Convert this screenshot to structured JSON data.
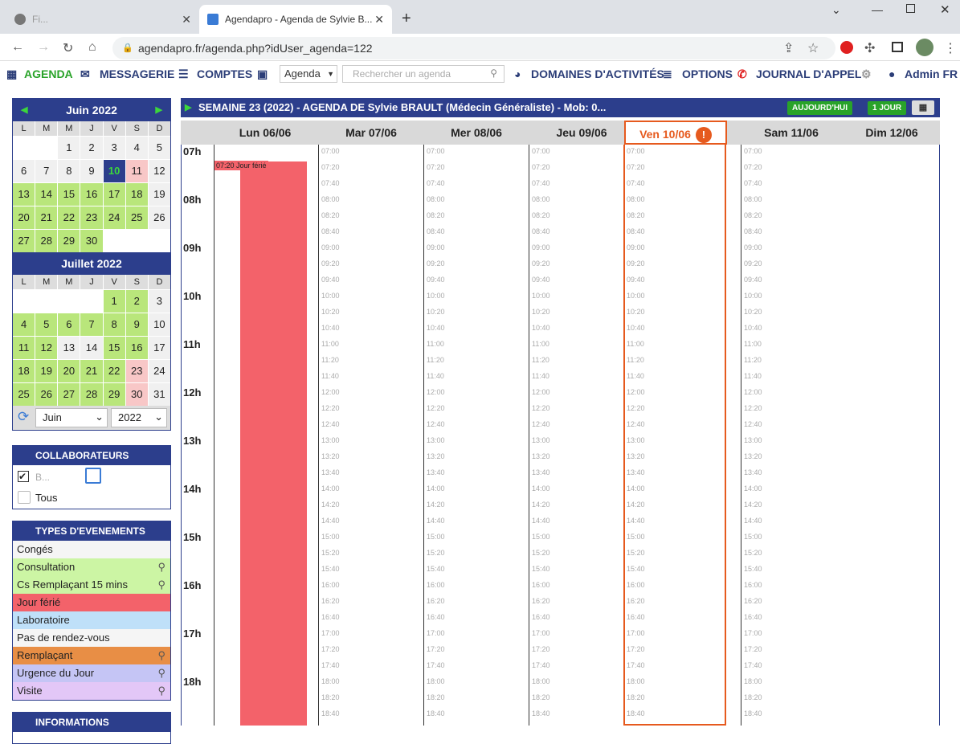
{
  "browser": {
    "tab1_title": "Fi...",
    "tab2_title": "Agendapro - Agenda de Sylvie B...",
    "url": "agendapro.fr/agenda.php?idUser_agenda=122"
  },
  "nav": {
    "agenda": "AGENDA",
    "messagerie": "MESSAGERIE",
    "comptes": "COMPTES",
    "select": "Agenda",
    "search_placeholder": "Rechercher un agenda",
    "domaines": "DOMAINES D'ACTIVITÉS",
    "options": "OPTIONS",
    "journal": "JOURNAL D'APPEL",
    "admin": "Admin FR"
  },
  "calendar": {
    "june": {
      "title": "Juin 2022",
      "dows": [
        "L",
        "M",
        "M",
        "J",
        "V",
        "S",
        "D"
      ],
      "days": [
        [
          "",
          ""
        ],
        [
          "",
          ""
        ],
        [
          "1",
          "w"
        ],
        [
          "2",
          "w"
        ],
        [
          "3",
          "w"
        ],
        [
          "4",
          "w"
        ],
        [
          "5",
          "w"
        ],
        [
          "6",
          "w"
        ],
        [
          "7",
          "w"
        ],
        [
          "8",
          "w"
        ],
        [
          "9",
          "w"
        ],
        [
          "10",
          "t"
        ],
        [
          "11",
          "r"
        ],
        [
          "12",
          "w"
        ],
        [
          "13",
          "g"
        ],
        [
          "14",
          "g"
        ],
        [
          "15",
          "g"
        ],
        [
          "16",
          "g"
        ],
        [
          "17",
          "g"
        ],
        [
          "18",
          "g"
        ],
        [
          "19",
          "w"
        ],
        [
          "20",
          "g"
        ],
        [
          "21",
          "g"
        ],
        [
          "22",
          "g"
        ],
        [
          "23",
          "g"
        ],
        [
          "24",
          "g"
        ],
        [
          "25",
          "g"
        ],
        [
          "26",
          "w"
        ],
        [
          "27",
          "g"
        ],
        [
          "28",
          "g"
        ],
        [
          "29",
          "g"
        ],
        [
          "30",
          "g"
        ],
        [
          "",
          ""
        ],
        [
          "",
          ""
        ],
        [
          "",
          ""
        ]
      ]
    },
    "july": {
      "title": "Juillet 2022",
      "dows": [
        "L",
        "M",
        "M",
        "J",
        "V",
        "S",
        "D"
      ],
      "days": [
        [
          "",
          ""
        ],
        [
          "",
          ""
        ],
        [
          "",
          ""
        ],
        [
          "",
          ""
        ],
        [
          "1",
          "g"
        ],
        [
          "2",
          "g"
        ],
        [
          "3",
          "w"
        ],
        [
          "4",
          "g"
        ],
        [
          "5",
          "g"
        ],
        [
          "6",
          "g"
        ],
        [
          "7",
          "g"
        ],
        [
          "8",
          "g"
        ],
        [
          "9",
          "g"
        ],
        [
          "10",
          "w"
        ],
        [
          "11",
          "g"
        ],
        [
          "12",
          "g"
        ],
        [
          "13",
          "w"
        ],
        [
          "14",
          "w"
        ],
        [
          "15",
          "g"
        ],
        [
          "16",
          "g"
        ],
        [
          "17",
          "w"
        ],
        [
          "18",
          "g"
        ],
        [
          "19",
          "g"
        ],
        [
          "20",
          "g"
        ],
        [
          "21",
          "g"
        ],
        [
          "22",
          "g"
        ],
        [
          "23",
          "r"
        ],
        [
          "24",
          "w"
        ],
        [
          "25",
          "g"
        ],
        [
          "26",
          "g"
        ],
        [
          "27",
          "g"
        ],
        [
          "28",
          "g"
        ],
        [
          "29",
          "g"
        ],
        [
          "30",
          "r"
        ],
        [
          "31",
          "w"
        ]
      ]
    },
    "month_select": "Juin",
    "year_select": "2022"
  },
  "collaborateurs": {
    "title": "COLLABORATEURS",
    "item1": "B...",
    "item2": "Tous"
  },
  "types": {
    "title": "TYPES D'EVENEMENTS",
    "items": [
      {
        "label": "Congés",
        "color": "#f5f5f5"
      },
      {
        "label": "Consultation",
        "color": "#ccf5a4"
      },
      {
        "label": "Cs Remplaçant 15 mins",
        "color": "#ccf5a4"
      },
      {
        "label": "Jour férié",
        "color": "#f3626a"
      },
      {
        "label": "Laboratoire",
        "color": "#bfe0f9"
      },
      {
        "label": "Pas de rendez-vous",
        "color": "#f5f5f5"
      },
      {
        "label": "Remplaçant",
        "color": "#e88e45"
      },
      {
        "label": "Urgence du Jour",
        "color": "#c5c5f5"
      },
      {
        "label": "Visite",
        "color": "#e3c7f7"
      }
    ]
  },
  "informations": "INFORMATIONS",
  "header": {
    "title": "SEMAINE 23 (2022) - AGENDA DE Sylvie BRAULT (Médecin Généraliste) - Mob: 0...",
    "today": "AUJOURD'HUI",
    "oneday": "1 JOUR"
  },
  "days": [
    "Lun 06/06",
    "Mar 07/06",
    "Mer 08/06",
    "Jeu 09/06",
    "Ven 10/06",
    "Sam 11/06",
    "Dim 12/06"
  ],
  "hours": [
    "07h",
    "08h",
    "09h",
    "10h",
    "11h",
    "12h",
    "13h",
    "14h",
    "15h",
    "16h",
    "17h",
    "18h"
  ],
  "ferie": {
    "time": "07:20",
    "label": "Jour férié"
  }
}
